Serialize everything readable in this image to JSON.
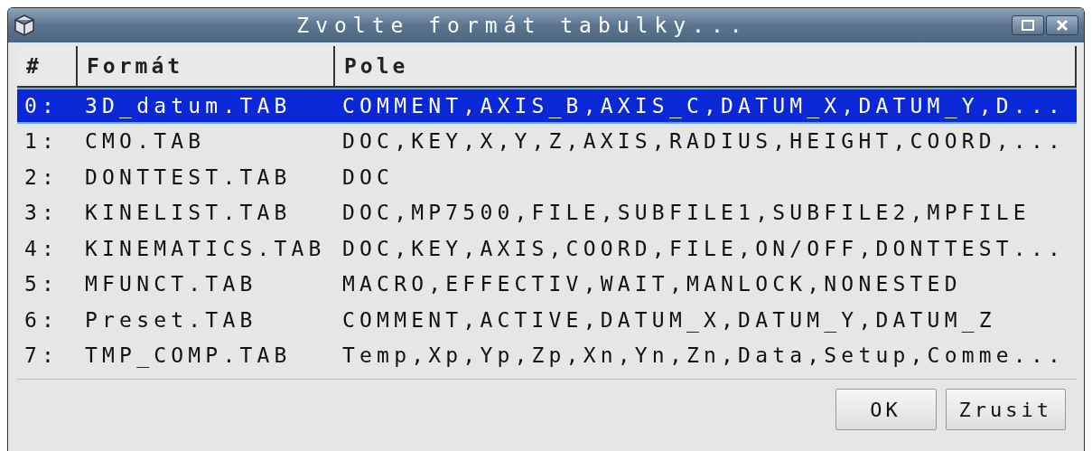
{
  "window": {
    "title": "Zvolte formát tabulky..."
  },
  "table": {
    "columns": [
      "#",
      "Formát",
      "Pole"
    ],
    "rows": [
      {
        "index": "0:",
        "format": "3D_datum.TAB",
        "fields": "COMMENT,AXIS_B,AXIS_C,DATUM_X,DATUM_Y,D...",
        "selected": true
      },
      {
        "index": "1:",
        "format": "CMO.TAB",
        "fields": "DOC,KEY,X,Y,Z,AXIS,RADIUS,HEIGHT,COORD,...",
        "selected": false
      },
      {
        "index": "2:",
        "format": "DONTTEST.TAB",
        "fields": "DOC",
        "selected": false
      },
      {
        "index": "3:",
        "format": "KINELIST.TAB",
        "fields": "DOC,MP7500,FILE,SUBFILE1,SUBFILE2,MPFILE",
        "selected": false
      },
      {
        "index": "4:",
        "format": "KINEMATICS.TAB",
        "fields": "DOC,KEY,AXIS,COORD,FILE,ON/OFF,DONTTEST...",
        "selected": false
      },
      {
        "index": "5:",
        "format": "MFUNCT.TAB",
        "fields": "MACRO,EFFECTIV,WAIT,MANLOCK,NONESTED",
        "selected": false
      },
      {
        "index": "6:",
        "format": "Preset.TAB",
        "fields": "COMMENT,ACTIVE,DATUM_X,DATUM_Y,DATUM_Z",
        "selected": false
      },
      {
        "index": "7:",
        "format": "TMP_COMP.TAB",
        "fields": "Temp,Xp,Yp,Zp,Xn,Yn,Zn,Data,Setup,Comme...",
        "selected": false
      }
    ]
  },
  "buttons": [
    "OK",
    "Zrusit"
  ]
}
